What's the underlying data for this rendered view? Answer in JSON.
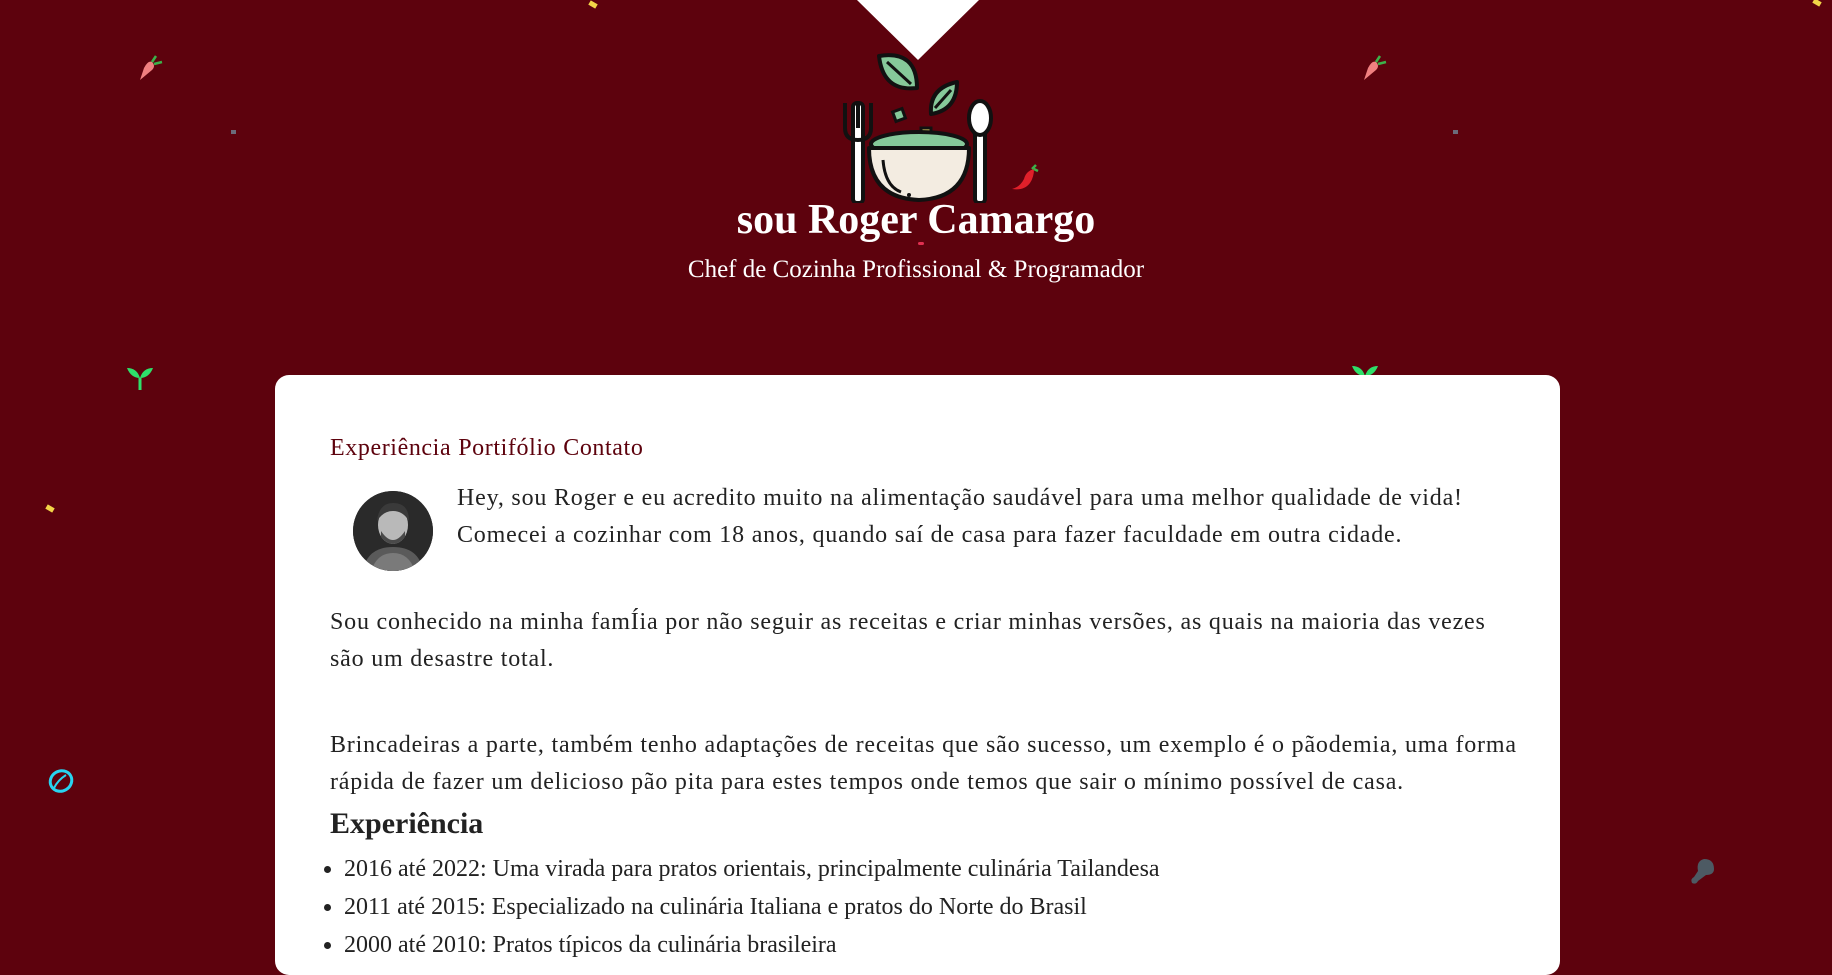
{
  "header": {
    "title": "sou Roger Camargo",
    "subtitle": "Chef de Cozinha Profissional & Programador"
  },
  "nav": {
    "items": [
      {
        "label": "Experiência"
      },
      {
        "label": "Portifólio"
      },
      {
        "label": "Contato"
      }
    ]
  },
  "intro": {
    "p1": "Hey, sou Roger e eu acredito muito na alimentação saudável para uma melhor qualidade de vida! Comecei a cozinhar com 18 anos, quando saí de casa para fazer faculdade em outra cidade.",
    "p2": "Sou conhecido na minha famÍia por não seguir as receitas e criar minhas versões, as quais na maioria das vezes são um desastre total.",
    "p3": "Brincadeiras a parte, também tenho adaptações de receitas que são sucesso, um exemplo é o pãodemia, uma forma rápida de fazer um delicioso pão pita para estes tempos onde temos que sair o mínimo possível de casa."
  },
  "experience": {
    "title": "Experiência",
    "items": [
      "2016 até 2022: Uma virada para pratos orientais, principalmente culinária Tailandesa",
      "2011 até 2015: Especializado na culinária Italiana e pratos do Norte do Brasil",
      "2000 até 2010: Pratos típicos da culinária brasileira"
    ]
  },
  "colors": {
    "background": "#5d020d",
    "card": "#ffffff",
    "accent": "#5d020d"
  }
}
